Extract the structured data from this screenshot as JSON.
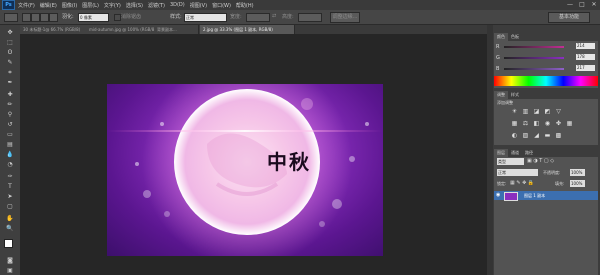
{
  "app": {
    "logo": "Ps"
  },
  "menu": [
    "文件(F)",
    "编辑(E)",
    "图像(I)",
    "图层(L)",
    "文字(Y)",
    "选择(S)",
    "滤镜(T)",
    "3D(D)",
    "视图(V)",
    "窗口(W)",
    "帮助(H)"
  ],
  "window_controls": {
    "minimize": "—",
    "maximize": "□",
    "close": "✕"
  },
  "options": {
    "feather_label": "羽化:",
    "feather_value": "0 像素",
    "antialias_label": "消除锯齿",
    "style_label": "样式:",
    "style_value": "正常",
    "width_label": "宽度:",
    "height_label": "高度:",
    "refine_edge": "调整边缘...",
    "workspace": "基本功能"
  },
  "tabs": [
    "30 未标题-1@ 66.7% (RGB/8)",
    "mid-autumn.jpg @ 100% (RGB/8)",
    "背景副本...",
    "2.jpg @ 33.3% (图层 1 副本, RGB/8)"
  ],
  "artwork": {
    "text": "中秋"
  },
  "color_panel": {
    "tabs": [
      "颜色",
      "色板"
    ],
    "channels": [
      {
        "label": "R",
        "value": "214",
        "fill": "#c22e93"
      },
      {
        "label": "G",
        "value": "178",
        "fill": "#8a2fc1"
      },
      {
        "label": "B",
        "value": "217",
        "fill": "#8e60c8"
      }
    ]
  },
  "adjustments_panel": {
    "tabs": [
      "调整",
      "样式"
    ],
    "title": "添加调整"
  },
  "layers_panel": {
    "tabs": [
      "图层",
      "通道",
      "路径"
    ],
    "kind_label": "类型",
    "blend_mode": "正常",
    "opacity_label": "不透明度:",
    "opacity_value": "100%",
    "lock_label": "锁定:",
    "fill_label": "填充:",
    "fill_value": "100%",
    "layers": [
      {
        "name": "图层 1 副本",
        "selected": true
      }
    ]
  },
  "colors": {
    "accent": "#3c6fb0",
    "artwork_purple": "#8a2fbf"
  }
}
